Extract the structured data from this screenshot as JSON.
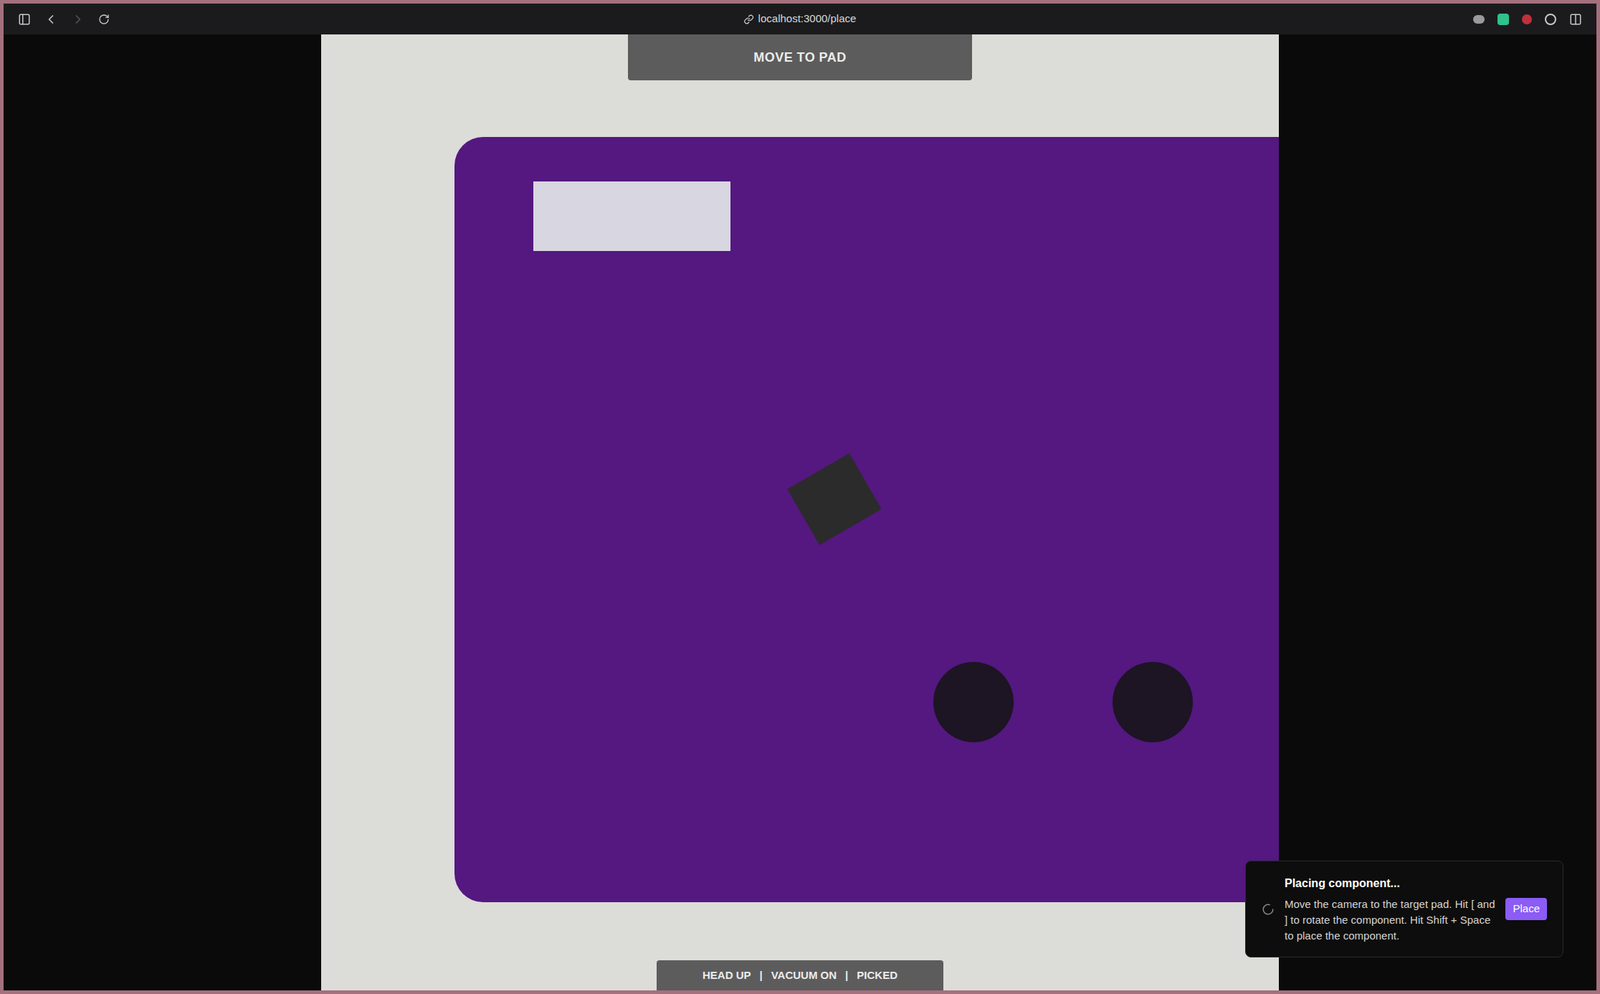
{
  "browser": {
    "url": "localhost:3000/place",
    "back_enabled": true,
    "forward_enabled": false
  },
  "banner": {
    "text": "MOVE TO PAD"
  },
  "status_bar": {
    "items": [
      "HEAD UP",
      "VACUUM ON",
      "PICKED"
    ],
    "separator": "|"
  },
  "toast": {
    "title": "Placing component...",
    "message": "Move the camera to the target pad. Hit [ and ] to rotate the component. Hit Shift + Space to place the component.",
    "button": "Place",
    "loading": true
  }
}
